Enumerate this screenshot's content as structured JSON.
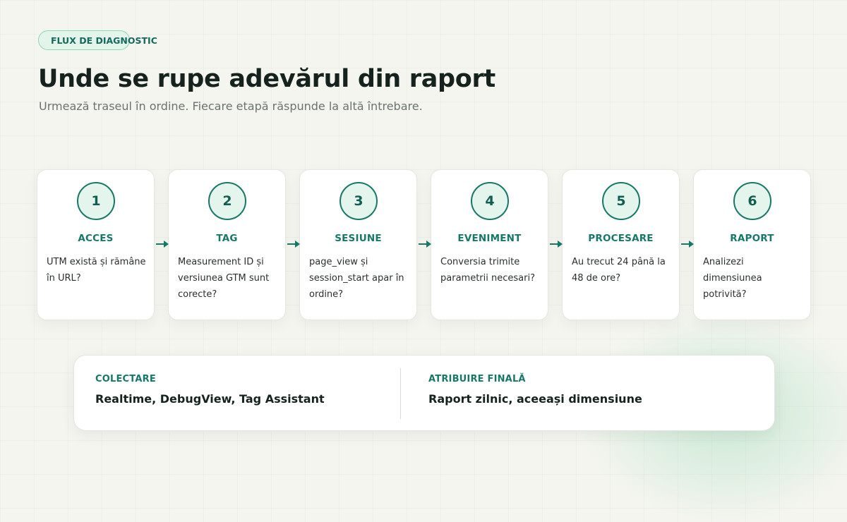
{
  "header": {
    "eyebrow": "FLUX DE DIAGNOSTIC",
    "title": "Unde se rupe adevărul din raport",
    "subtitle": "Urmează traseul în ordine. Fiecare etapă răspunde la altă întrebare."
  },
  "steps": [
    {
      "number": "1",
      "title": "ACCES",
      "description": "UTM există și rămâne în URL?"
    },
    {
      "number": "2",
      "title": "TAG",
      "description": "Measurement ID și versiunea GTM sunt corecte?"
    },
    {
      "number": "3",
      "title": "SESIUNE",
      "description": "page_view și session_start apar în ordine?"
    },
    {
      "number": "4",
      "title": "EVENIMENT",
      "description": "Conversia trimite parametrii necesari?"
    },
    {
      "number": "5",
      "title": "PROCESARE",
      "description": "Au trecut 24 până la 48 de ore?"
    },
    {
      "number": "6",
      "title": "RAPORT",
      "description": "Analizezi dimensiunea potrivită?"
    }
  ],
  "summary": {
    "left": {
      "label": "COLECTARE",
      "value": "Realtime, DebugView, Tag Assistant"
    },
    "right": {
      "label": "ATRIBUIRE FINALĂ",
      "value": "Raport zilnic, aceeași dimensiune"
    }
  },
  "colors": {
    "accent": "#177868",
    "accent_light": "#e4f5ed",
    "background": "#f5f5f0",
    "title": "#16221e",
    "muted": "#6b7370"
  },
  "icons": {
    "connector": "arrow-right-icon"
  }
}
